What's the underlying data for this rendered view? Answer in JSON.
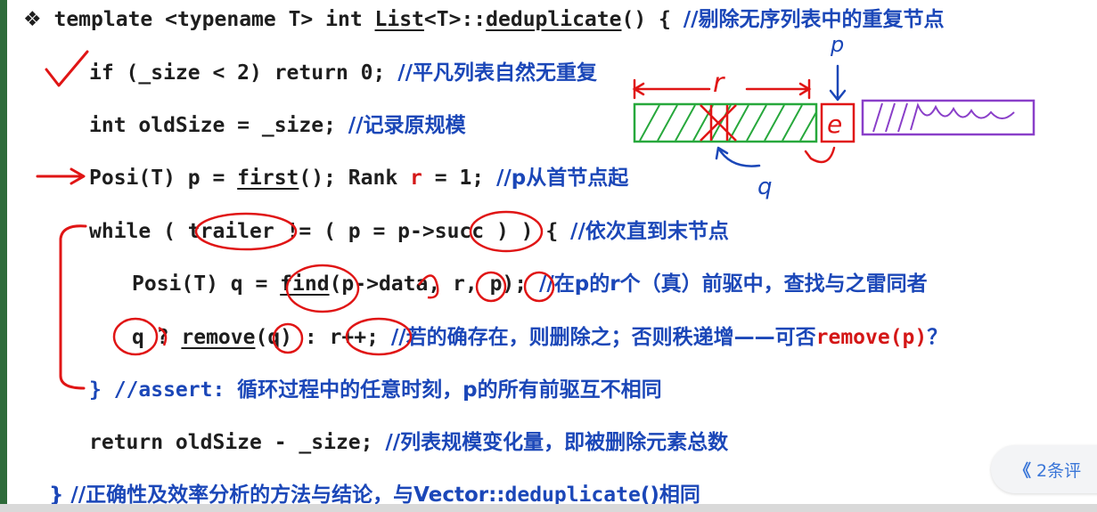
{
  "slide": {
    "bullet": "❖",
    "header": {
      "code_prefix": "template <typename T> int ",
      "class_name": "List",
      "template_arg": "<T>::",
      "method": "deduplicate",
      "code_suffix": "() { ",
      "comment": "//剔除无序列表中的重复节点"
    },
    "lines": [
      {
        "code": "if (_size < 2) return 0; ",
        "comment": "//平凡列表自然无重复"
      },
      {
        "code": "int oldSize = _size; ",
        "comment": "//记录原规模"
      },
      {
        "code_a": "Posi(T) p = ",
        "code_b": "first",
        "code_c": "(); Rank ",
        "code_r": "r",
        "code_d": " = 1; ",
        "comment": "//p从首节点起"
      },
      {
        "code": "while ( trailer != ( p = p->succ ) ) { ",
        "comment": "//依次直到末节点"
      },
      {
        "code_a": "Posi(T) q = ",
        "code_b": "find",
        "code_c": "(p->data, r, p); ",
        "comment": "//在p的r个（真）前驱中，查找与之雷同者"
      },
      {
        "code_a": "q ? ",
        "code_b": "remove",
        "code_c": "(q) : r++; ",
        "comment": "//若的确存在，则删除之；否则秩递增——可否",
        "code_red": "remove(p)",
        "tail": "？"
      },
      {
        "code": "} //assert: ",
        "comment": "循环过程中的任意时刻，p的所有前驱互不相同"
      },
      {
        "code": "return oldSize - _size; ",
        "comment": "//列表规模变化量，即被删除元素总数"
      },
      {
        "code_a": "} //正确性及效率分析的方法与结论，与Vector::",
        "code_b": "deduplicate",
        "code_c": "()相同"
      }
    ]
  },
  "annotations": {
    "label_r": "r",
    "label_p": "p",
    "label_e": "e",
    "label_q": "q"
  },
  "colors": {
    "code": "#1e1e1e",
    "comment": "#1b47b8",
    "highlight": "#d41717",
    "ink_red": "#e01515",
    "ink_green": "#27a83c",
    "ink_purple": "#8a3fc9",
    "ink_blue": "#1b47b8"
  },
  "comments_button": {
    "chevron": "《",
    "label": "2条评"
  }
}
